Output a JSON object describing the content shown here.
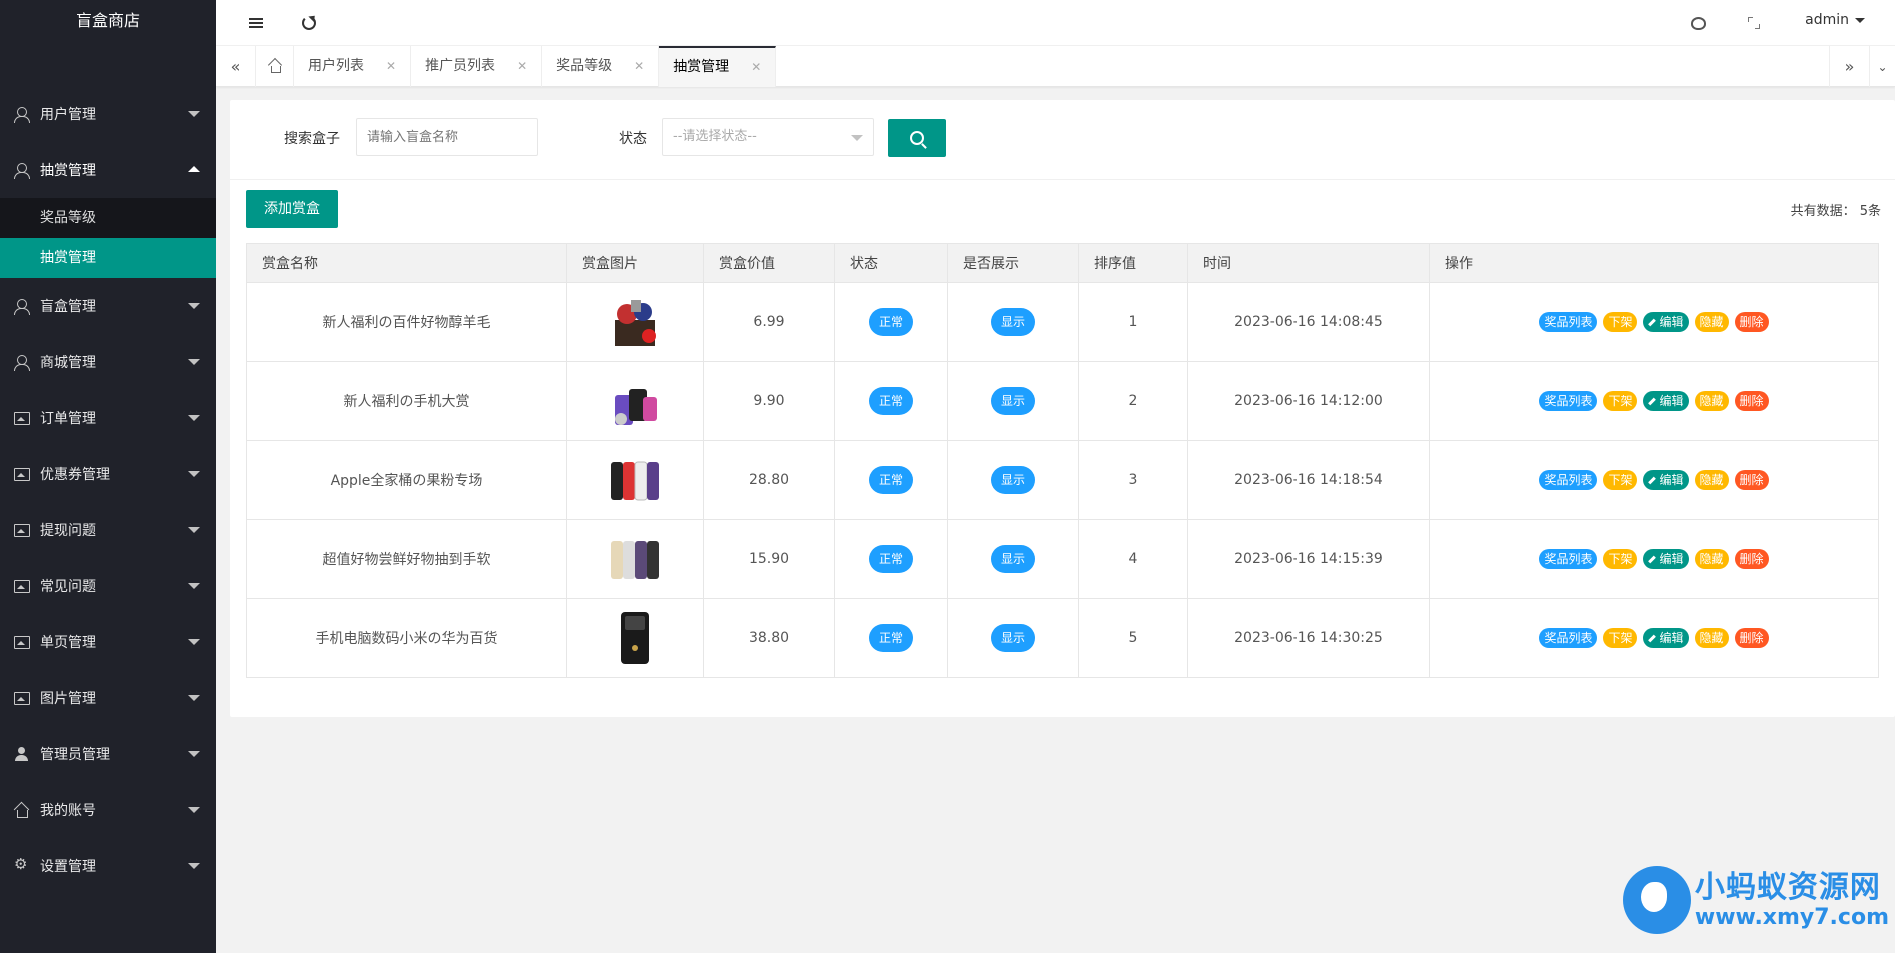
{
  "app": {
    "title": "盲盒商店"
  },
  "sidebar": {
    "items": [
      {
        "label": "用户管理",
        "icon": "user-icon"
      },
      {
        "label": "抽赏管理",
        "icon": "user-icon",
        "open": true,
        "children": [
          {
            "label": "奖品等级"
          },
          {
            "label": "抽赏管理",
            "active": true
          }
        ]
      },
      {
        "label": "盲盒管理",
        "icon": "user-icon"
      },
      {
        "label": "商城管理",
        "icon": "user-icon"
      },
      {
        "label": "订单管理",
        "icon": "image-icon"
      },
      {
        "label": "优惠券管理",
        "icon": "image-icon"
      },
      {
        "label": "提现问题",
        "icon": "image-icon"
      },
      {
        "label": "常见问题",
        "icon": "image-icon"
      },
      {
        "label": "单页管理",
        "icon": "image-icon"
      },
      {
        "label": "图片管理",
        "icon": "image-icon"
      },
      {
        "label": "管理员管理",
        "icon": "admin-icon"
      },
      {
        "label": "我的账号",
        "icon": "home-icon"
      },
      {
        "label": "设置管理",
        "icon": "gear-icon"
      }
    ]
  },
  "header": {
    "user": "admin"
  },
  "tabs": [
    {
      "label": "用户列表"
    },
    {
      "label": "推广员列表"
    },
    {
      "label": "奖品等级"
    },
    {
      "label": "抽赏管理",
      "active": true
    }
  ],
  "search": {
    "box_label": "搜索盒子",
    "box_placeholder": "请输入盲盒名称",
    "status_label": "状态",
    "status_placeholder": "--请选择状态--"
  },
  "toolbar": {
    "add_label": "添加赏盒",
    "total_label": "共有数据：",
    "total_value": "5条"
  },
  "table": {
    "headers": [
      "赏盒名称",
      "赏盒图片",
      "赏盒价值",
      "状态",
      "是否展示",
      "排序值",
      "时间",
      "操作"
    ],
    "rows": [
      {
        "name": "新人福利の百件好物醇羊毛",
        "price": "6.99",
        "status": "正常",
        "show": "显示",
        "sort": "1",
        "time": "2023-06-16 14:08:45"
      },
      {
        "name": "新人福利の手机大赏",
        "price": "9.90",
        "status": "正常",
        "show": "显示",
        "sort": "2",
        "time": "2023-06-16 14:12:00"
      },
      {
        "name": "Apple全家桶の果粉专场",
        "price": "28.80",
        "status": "正常",
        "show": "显示",
        "sort": "3",
        "time": "2023-06-16 14:18:54"
      },
      {
        "name": "超值好物尝鲜好物抽到手软",
        "price": "15.90",
        "status": "正常",
        "show": "显示",
        "sort": "4",
        "time": "2023-06-16 14:15:39"
      },
      {
        "name": "手机电脑数码小米の华为百货",
        "price": "38.80",
        "status": "正常",
        "show": "显示",
        "sort": "5",
        "time": "2023-06-16 14:30:25"
      }
    ],
    "ops": {
      "prizes": "奖品列表",
      "offline": "下架",
      "edit": "编辑",
      "hide": "隐藏",
      "delete": "删除"
    }
  },
  "watermark": {
    "title": "小蚂蚁资源网",
    "url": "www.xmy7.com"
  },
  "colors": {
    "primary": "#009688",
    "blue": "#1e9fff",
    "yellow": "#ffb800",
    "red": "#ff5722",
    "sidebar": "#20222a"
  }
}
